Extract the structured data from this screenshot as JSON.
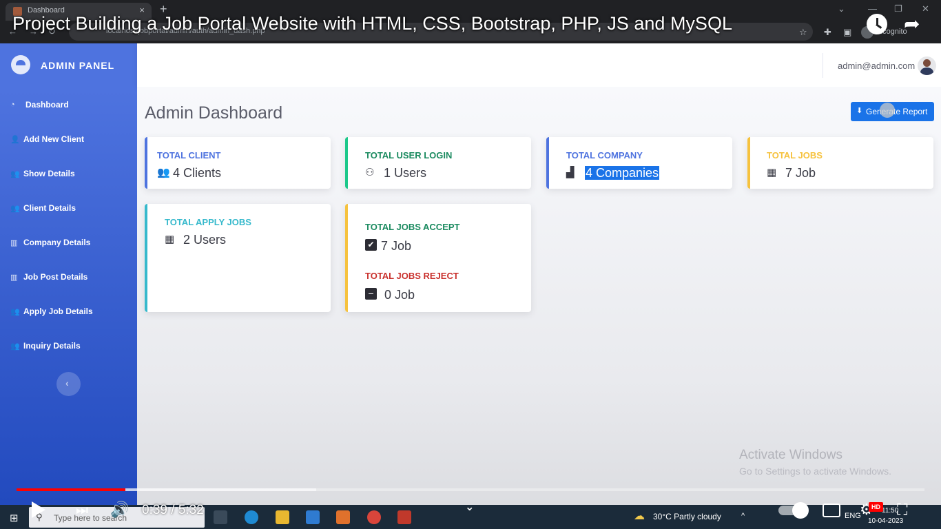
{
  "browser": {
    "tab_title": "Dashboard",
    "tab_close": "×",
    "new_tab": "+",
    "url": "localhost/jobportal/admin/auth/admin_dash.php",
    "incognito_label": "Incognito",
    "icons": [
      "back-icon",
      "forward-icon",
      "reload-icon",
      "home-icon",
      "star-icon",
      "extensions-icon",
      "sidepanel-icon",
      "menu-icon"
    ]
  },
  "video": {
    "title": "Project Building a Job Portal Website with HTML, CSS, Bootstrap, PHP, JS and MySQL",
    "time": "0:39 / 5:32",
    "progress_played": 0.12,
    "progress_buffered": 0.33,
    "hd_badge": "HD"
  },
  "sidebar": {
    "brand": "ADMIN PANEL",
    "items": [
      {
        "label": "Dashboard",
        "icon": "tachometer-icon",
        "glyph": "◔"
      },
      {
        "label": "Add New Client",
        "icon": "user-plus-icon",
        "glyph": "👤"
      },
      {
        "label": "Show Details",
        "icon": "users-icon",
        "glyph": "👥"
      },
      {
        "label": "Client Details",
        "icon": "users-icon",
        "glyph": "👥"
      },
      {
        "label": "Company Details",
        "icon": "building-icon",
        "glyph": "▥"
      },
      {
        "label": "Job Post Details",
        "icon": "building-icon",
        "glyph": "▥"
      },
      {
        "label": "Apply Job Details",
        "icon": "users-icon",
        "glyph": "👥"
      },
      {
        "label": "Inquiry Details",
        "icon": "users-icon",
        "glyph": "👥"
      }
    ],
    "toggle_glyph": "‹"
  },
  "topbar": {
    "user_email": "admin@admin.com"
  },
  "main": {
    "page_title": "Admin Dashboard",
    "report_button": "Generate Report",
    "cards": [
      {
        "title": "TOTAL CLIENT",
        "value": "4 Clients",
        "icon": "users-icon",
        "glyph": "👥",
        "color": "#4e73df"
      },
      {
        "title": "TOTAL USER LOGIN",
        "value": "1 Users",
        "icon": "user-check-icon",
        "glyph": "⚇",
        "color": "#1cc88a"
      },
      {
        "title": "TOTAL COMPANY",
        "value": "4 Companies",
        "icon": "city-icon",
        "glyph": "▟",
        "color": "#4e73df"
      },
      {
        "title": "TOTAL JOBS",
        "value": "7 Job",
        "icon": "building-icon",
        "glyph": "▦",
        "color": "#f6c23e"
      },
      {
        "title": "TOTAL APPLY JOBS",
        "value": "2 Users",
        "icon": "building-icon",
        "glyph": "▦",
        "color": "#36b9cc"
      }
    ],
    "accept_reject_card": {
      "accept_title": "TOTAL JOBS ACCEPT",
      "accept_value": "7 Job",
      "accept_glyph": "✔",
      "reject_title": "TOTAL JOBS REJECT",
      "reject_value": "0 Job",
      "reject_glyph": "−",
      "accept_color": "#1a8a5f",
      "reject_color": "#e74a3b",
      "bar_color": "#f6c23e"
    },
    "watermark_line1": "Activate Windows",
    "watermark_line2": "Go to Settings to activate Windows."
  },
  "taskbar": {
    "search_placeholder": "Type here to search",
    "weather": "30°C  Partly cloudy",
    "lang": "ENG",
    "time": "11:50",
    "date": "10-04-2023"
  }
}
